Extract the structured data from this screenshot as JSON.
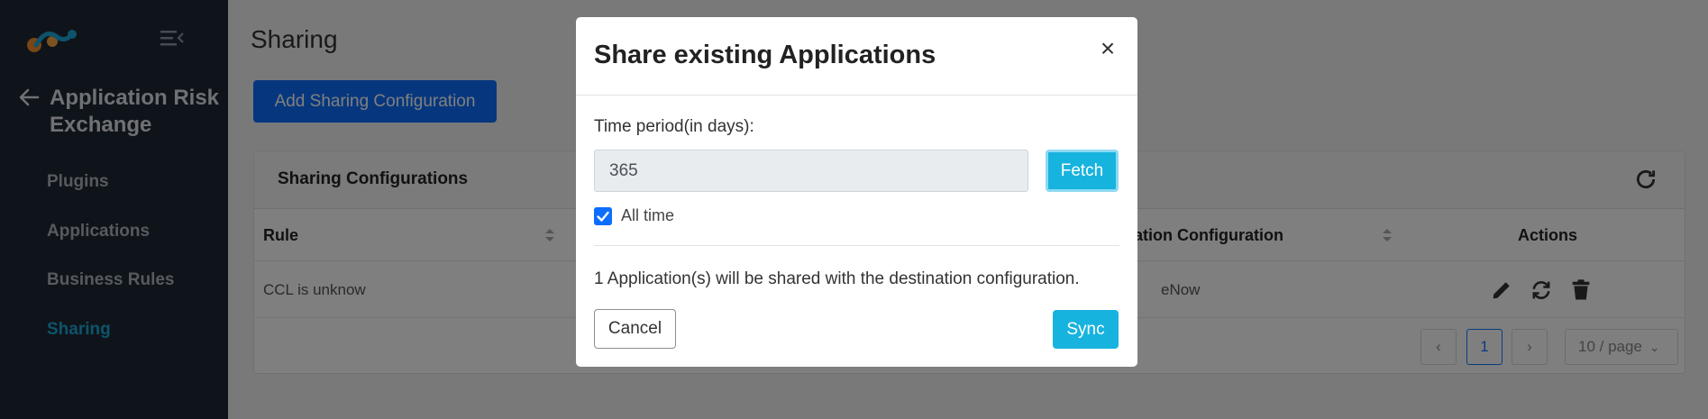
{
  "sidebar": {
    "app_title": "Application Risk Exchange",
    "items": [
      {
        "label": "Plugins"
      },
      {
        "label": "Applications"
      },
      {
        "label": "Business Rules"
      },
      {
        "label": "Sharing"
      }
    ],
    "active_item": "Sharing"
  },
  "main": {
    "page_title": "Sharing",
    "add_button": "Add Sharing Configuration",
    "card": {
      "title": "Sharing Configurations",
      "columns": [
        "Rule",
        "nation Configuration",
        "Actions"
      ],
      "rows": [
        {
          "rule": "CCL is unknow",
          "destination": "eNow"
        }
      ]
    },
    "pagination": {
      "current_page": "1",
      "page_size": "10 / page"
    }
  },
  "modal": {
    "title": "Share existing Applications",
    "field_label": "Time period(in days):",
    "days_value": "365",
    "fetch_label": "Fetch",
    "all_time_label": "All time",
    "all_time_checked": true,
    "info_text": "1 Application(s) will be shared with the destination configuration.",
    "cancel_label": "Cancel",
    "sync_label": "Sync"
  },
  "colors": {
    "sidebar_bg": "#1e2834",
    "active_nav": "#1aa7d9",
    "primary": "#0d6efd",
    "info": "#17b3df"
  }
}
